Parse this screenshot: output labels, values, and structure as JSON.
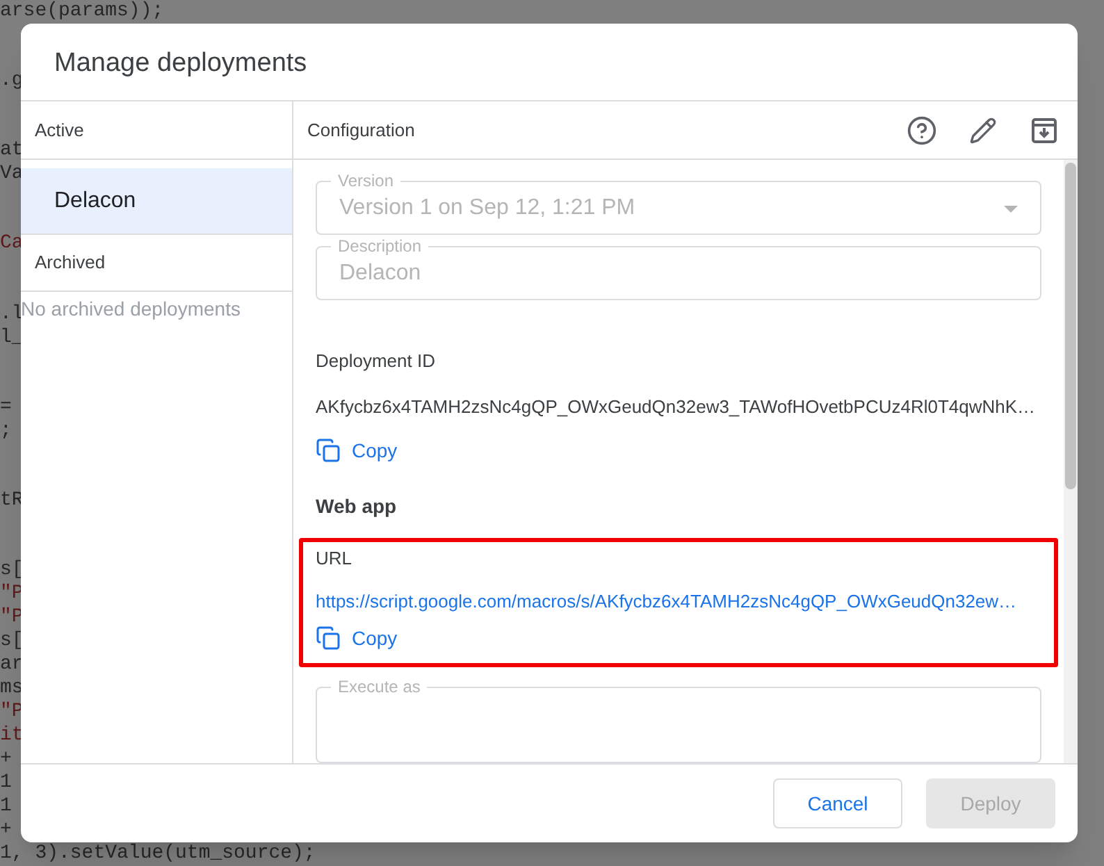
{
  "background_code": {
    "blocks": [
      [
        {
          "text": "arse(params));",
          "kind": "plain"
        }
      ],
      [
        {
          "text": ".g",
          "kind": "plain"
        }
      ],
      [
        {
          "text": "at",
          "kind": "plain"
        },
        {
          "text": "Va",
          "kind": "plain"
        }
      ],
      [
        {
          "text": "Ca",
          "kind": "string"
        }
      ],
      [
        {
          "text": ".l",
          "kind": "plain"
        },
        {
          "text": "l_",
          "kind": "plain"
        }
      ],
      [
        {
          "text": "=",
          "kind": "plain"
        },
        {
          "text": ";",
          "kind": "plain"
        }
      ],
      [
        {
          "text": "tR",
          "kind": "plain"
        }
      ],
      [
        {
          "text": "s[",
          "kind": "plain"
        },
        {
          "text": "\"P",
          "kind": "string"
        },
        {
          "text": "\"P",
          "kind": "string"
        },
        {
          "text": "s[",
          "kind": "plain"
        },
        {
          "text": "ar",
          "kind": "plain"
        },
        {
          "text": "ms",
          "kind": "plain"
        },
        {
          "text": "\"P",
          "kind": "string"
        },
        {
          "text": "it",
          "kind": "string"
        },
        {
          "text": "+",
          "kind": "plain"
        },
        {
          "text": "1",
          "kind": "plain"
        },
        {
          "text": "1",
          "kind": "plain"
        },
        {
          "text": "+",
          "kind": "plain"
        },
        {
          "text": "1, 3).setValue(utm_source);",
          "kind": "plain"
        }
      ]
    ]
  },
  "dialog": {
    "title": "Manage deployments",
    "sidebar": {
      "active_heading": "Active",
      "items": [
        {
          "label": "Delacon",
          "selected": true
        }
      ],
      "archived_heading": "Archived",
      "archived_empty": "No archived deployments"
    },
    "configuration": {
      "heading": "Configuration",
      "version": {
        "label": "Version",
        "value": "Version 1 on Sep 12, 1:21 PM",
        "disabled": true
      },
      "description": {
        "label": "Description",
        "value": "Delacon",
        "disabled": true
      },
      "deployment_id": {
        "label": "Deployment ID",
        "value": "AKfycbz6x4TAMH2zsNc4gQP_OWxGeudQn32ew3_TAWofHOvetbPCUz4Rl0T4qwNhK…",
        "copy": "Copy"
      },
      "web_app": {
        "heading": "Web app",
        "url_label": "URL",
        "url": "https://script.google.com/macros/s/AKfycbz6x4TAMH2zsNc4gQP_OWxGeudQn32ew…",
        "copy": "Copy",
        "highlighted": true
      },
      "execute_as": {
        "label": "Execute as",
        "disabled": true
      }
    },
    "buttons": [
      {
        "label": "Cancel",
        "disabled": false
      },
      {
        "label": "Deploy",
        "disabled": true
      }
    ]
  }
}
